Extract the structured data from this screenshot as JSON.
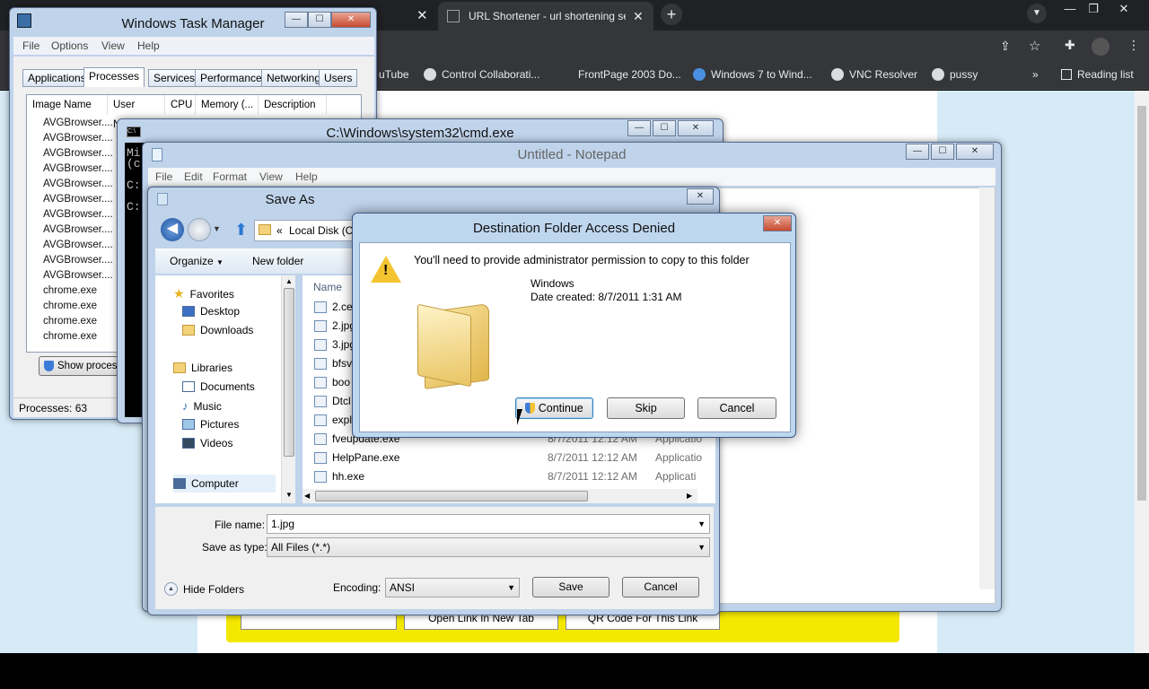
{
  "browser": {
    "tab_title": "URL Shortener - url shortening se",
    "bookmarks": [
      "uTube",
      "Control Collaborati...",
      "FrontPage 2003 Do...",
      "Windows 7 to Wind...",
      "VNC Resolver",
      "pussy"
    ],
    "reading_list": "Reading list",
    "overflow": "»",
    "page_buttons": [
      "Open Link In New Tab",
      "QR Code For This Link"
    ]
  },
  "task_manager": {
    "title": "Windows Task Manager",
    "menu": [
      "File",
      "Options",
      "View",
      "Help"
    ],
    "tabs": [
      "Applications",
      "Processes",
      "Services",
      "Performance",
      "Networking",
      "Users"
    ],
    "columns": [
      "Image Name",
      "User Name",
      "CPU",
      "Memory (...",
      "Description"
    ],
    "rows": [
      "AVGBrowser....",
      "AVGBrowser....",
      "AVGBrowser....",
      "AVGBrowser....",
      "AVGBrowser....",
      "AVGBrowser....",
      "AVGBrowser....",
      "AVGBrowser....",
      "AVGBrowser....",
      "AVGBrowser....",
      "AVGBrowser....",
      "chrome.exe",
      "chrome.exe",
      "chrome.exe",
      "chrome.exe"
    ],
    "show_processes": "Show process",
    "status": "Processes: 63"
  },
  "cmd": {
    "title": "C:\\Windows\\system32\\cmd.exe",
    "lines": [
      "Mi",
      "(c",
      "",
      "C:",
      "",
      "C:"
    ]
  },
  "notepad": {
    "title": "Untitled - Notepad",
    "menu": [
      "File",
      "Edit",
      "Format",
      "View",
      "Help"
    ]
  },
  "save_as": {
    "title": "Save As",
    "path": "Local Disk (C:",
    "path_prefix": "«",
    "organize": "Organize",
    "new_folder": "New folder",
    "nav": {
      "favorites": "Favorites",
      "desktop": "Desktop",
      "downloads": "Downloads",
      "libraries": "Libraries",
      "documents": "Documents",
      "music": "Music",
      "pictures": "Pictures",
      "videos": "Videos",
      "computer": "Computer"
    },
    "name_col": "Name",
    "files": [
      {
        "name": "2.ce",
        "date": "",
        "type": ""
      },
      {
        "name": "2.jpg",
        "date": "",
        "type": ""
      },
      {
        "name": "3.jpg",
        "date": "",
        "type": ""
      },
      {
        "name": "bfsv",
        "date": "",
        "type": ""
      },
      {
        "name": "boo",
        "date": "",
        "type": ""
      },
      {
        "name": "Dtcl",
        "date": "",
        "type": ""
      },
      {
        "name": "expl",
        "date": "",
        "type": ""
      },
      {
        "name": "fveupdate.exe",
        "date": "8/7/2011 12:12 AM",
        "type": "Applicatio"
      },
      {
        "name": "HelpPane.exe",
        "date": "8/7/2011 12:12 AM",
        "type": "Applicatio"
      },
      {
        "name": "hh.exe",
        "date": "8/7/2011 12:12 AM",
        "type": "Applicati"
      }
    ],
    "file_name_label": "File name:",
    "file_name_value": "1.jpg",
    "save_type_label": "Save as type:",
    "save_type_value": "All Files  (*.*)",
    "hide_folders": "Hide Folders",
    "encoding_label": "Encoding:",
    "encoding_value": "ANSI",
    "save": "Save",
    "cancel": "Cancel"
  },
  "dialog": {
    "title": "Destination Folder Access Denied",
    "message": "You'll need to provide administrator permission to copy to this folder",
    "folder_name": "Windows",
    "date_created": "Date created: 8/7/2011 1:31 AM",
    "continue": "Continue",
    "skip": "Skip",
    "cancel": "Cancel"
  },
  "colors": {
    "chrome_dark": "#202124",
    "chrome_toolbar": "#35363a",
    "win7_frame": "#bfd3ea",
    "yellow": "#f4e800"
  }
}
